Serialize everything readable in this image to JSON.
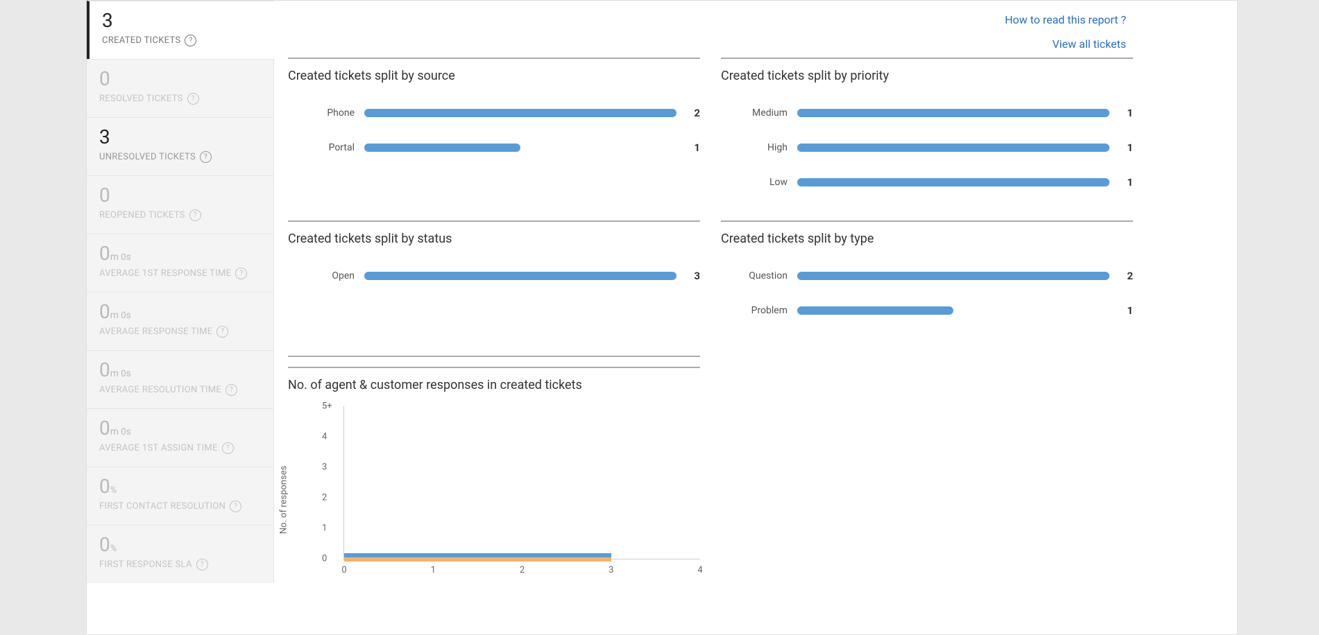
{
  "toplinks": {
    "help": "How to read this report ?",
    "viewAll": "View all tickets"
  },
  "sidebar": [
    {
      "id": "created",
      "value": "3",
      "unit": "",
      "label": "CREATED TICKETS",
      "active": true
    },
    {
      "id": "resolved",
      "value": "0",
      "unit": "",
      "label": "RESOLVED TICKETS"
    },
    {
      "id": "unresolved",
      "value": "3",
      "unit": "",
      "label": "UNRESOLVED TICKETS",
      "strong": true
    },
    {
      "id": "reopened",
      "value": "0",
      "unit": "",
      "label": "REOPENED TICKETS"
    },
    {
      "id": "avg-first-response",
      "value": "0",
      "unit": "m 0s",
      "label": "AVERAGE 1ST RESPONSE TIME"
    },
    {
      "id": "avg-response",
      "value": "0",
      "unit": "m 0s",
      "label": "AVERAGE RESPONSE TIME"
    },
    {
      "id": "avg-resolution",
      "value": "0",
      "unit": "m 0s",
      "label": "AVERAGE RESOLUTION TIME"
    },
    {
      "id": "avg-first-assign",
      "value": "0",
      "unit": "m 0s",
      "label": "AVERAGE 1ST ASSIGN TIME"
    },
    {
      "id": "fcr",
      "value": "0",
      "unit": "%",
      "label": "FIRST CONTACT RESOLUTION"
    },
    {
      "id": "fr-sla",
      "value": "0",
      "unit": "%",
      "label": "FIRST RESPONSE SLA"
    }
  ],
  "charts": {
    "source": {
      "title": "Created tickets split by source",
      "max": 2,
      "bars": [
        {
          "label": "Phone",
          "value": 2
        },
        {
          "label": "Portal",
          "value": 1
        }
      ]
    },
    "priority": {
      "title": "Created tickets split by priority",
      "max": 1,
      "bars": [
        {
          "label": "Medium",
          "value": 1
        },
        {
          "label": "High",
          "value": 1
        },
        {
          "label": "Low",
          "value": 1
        }
      ]
    },
    "status": {
      "title": "Created tickets split by status",
      "max": 3,
      "bars": [
        {
          "label": "Open",
          "value": 3
        }
      ]
    },
    "type": {
      "title": "Created tickets split by type",
      "max": 2,
      "bars": [
        {
          "label": "Question",
          "value": 2
        },
        {
          "label": "Problem",
          "value": 1
        }
      ]
    }
  },
  "responses": {
    "title": "No. of agent & customer responses in created tickets",
    "yTitle": "No. of responses",
    "yTicks": [
      "5+",
      "4",
      "3",
      "2",
      "1",
      "0"
    ],
    "xTicks": [
      "0",
      "1",
      "2",
      "3",
      "4"
    ],
    "xMax": 4,
    "series": [
      {
        "name": "agent",
        "color": "blue",
        "value": 3
      },
      {
        "name": "customer",
        "color": "orange",
        "value": 3
      }
    ]
  },
  "chart_data": [
    {
      "type": "bar",
      "title": "Created tickets split by source",
      "categories": [
        "Phone",
        "Portal"
      ],
      "values": [
        2,
        1
      ],
      "xlabel": "",
      "ylabel": "",
      "ylim": [
        0,
        2
      ]
    },
    {
      "type": "bar",
      "title": "Created tickets split by priority",
      "categories": [
        "Medium",
        "High",
        "Low"
      ],
      "values": [
        1,
        1,
        1
      ],
      "xlabel": "",
      "ylabel": "",
      "ylim": [
        0,
        1
      ]
    },
    {
      "type": "bar",
      "title": "Created tickets split by status",
      "categories": [
        "Open"
      ],
      "values": [
        3
      ],
      "xlabel": "",
      "ylabel": "",
      "ylim": [
        0,
        3
      ]
    },
    {
      "type": "bar",
      "title": "Created tickets split by type",
      "categories": [
        "Question",
        "Problem"
      ],
      "values": [
        2,
        1
      ],
      "xlabel": "",
      "ylabel": "",
      "ylim": [
        0,
        2
      ]
    },
    {
      "type": "area",
      "title": "No. of agent & customer responses in created tickets",
      "x": [
        0,
        1,
        2,
        3
      ],
      "series": [
        {
          "name": "agent",
          "values": [
            0,
            0,
            0,
            0
          ]
        },
        {
          "name": "customer",
          "values": [
            0,
            0,
            0,
            0
          ]
        }
      ],
      "ylabel": "No. of responses",
      "ylim": [
        0,
        5
      ]
    }
  ],
  "colors": {
    "bar": "#5b9bd5",
    "link": "#2a6ebb",
    "areaBlue": "#5b9bd5",
    "areaOrange": "#f6b26b"
  }
}
